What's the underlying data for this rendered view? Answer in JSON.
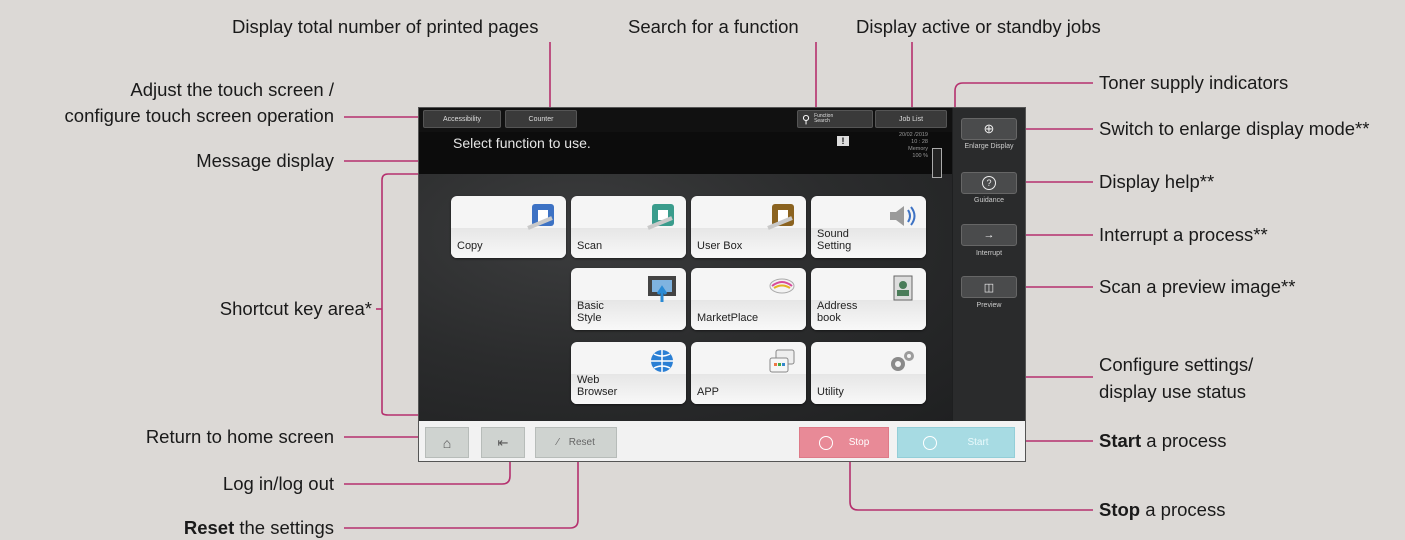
{
  "callouts": {
    "total_pages": "Display total number of printed pages",
    "search_function": "Search for a function",
    "active_jobs": "Display active or standby jobs",
    "adjust_touch_1": "Adjust the touch screen /",
    "adjust_touch_2": "configure touch screen operation",
    "toner": "Toner supply indicators",
    "enlarge": "Switch to enlarge display mode**",
    "message_display": "Message display",
    "display_help": "Display help**",
    "interrupt": "Interrupt a process**",
    "shortcut_area": "Shortcut key area*",
    "scan_preview": "Scan a preview image**",
    "configure_1": "Configure settings/",
    "configure_2": "display use status",
    "return_home": "Return to home screen",
    "start_bold": "Start",
    "start_rest": " a process",
    "login": "Log in/log out",
    "stop_bold": "Stop",
    "stop_rest": " a process",
    "reset_bold": "Reset",
    "reset_rest": " the settings"
  },
  "device": {
    "top_buttons": {
      "accessibility": "Accessibility",
      "counter": "Counter",
      "function_search": "Function Search",
      "job_list": "Job List"
    },
    "message": "Select function to use.",
    "status": {
      "date": "20/02 /2019",
      "time": "10 : 28",
      "memory_label": "Memory",
      "memory_value": "100 %"
    },
    "tiles": [
      {
        "label": "Copy",
        "icon": "copy-icon"
      },
      {
        "label": "Scan",
        "icon": "scan-icon"
      },
      {
        "label": "User Box",
        "icon": "user-box-icon"
      },
      {
        "label": "Sound Setting",
        "icon": "sound-icon"
      },
      {
        "label": "Basic Style",
        "icon": "basic-style-icon"
      },
      {
        "label": "MarketPlace",
        "icon": "marketplace-icon"
      },
      {
        "label": "Address book",
        "icon": "address-book-icon"
      },
      {
        "label": "Web Browser",
        "icon": "globe-icon"
      },
      {
        "label": "APP",
        "icon": "app-icon"
      },
      {
        "label": "Utility",
        "icon": "gear-icon"
      }
    ],
    "side": {
      "enlarge_display": "Enlarge Display",
      "guidance": "Guidance",
      "interrupt": "Interrupt",
      "preview": "Preview"
    },
    "bottom": {
      "reset": "Reset",
      "stop": "Stop",
      "start": "Start"
    }
  },
  "colors": {
    "leader_line": "#b5306e",
    "stop_button": "#e88a97",
    "start_button": "#a7dbe3"
  }
}
